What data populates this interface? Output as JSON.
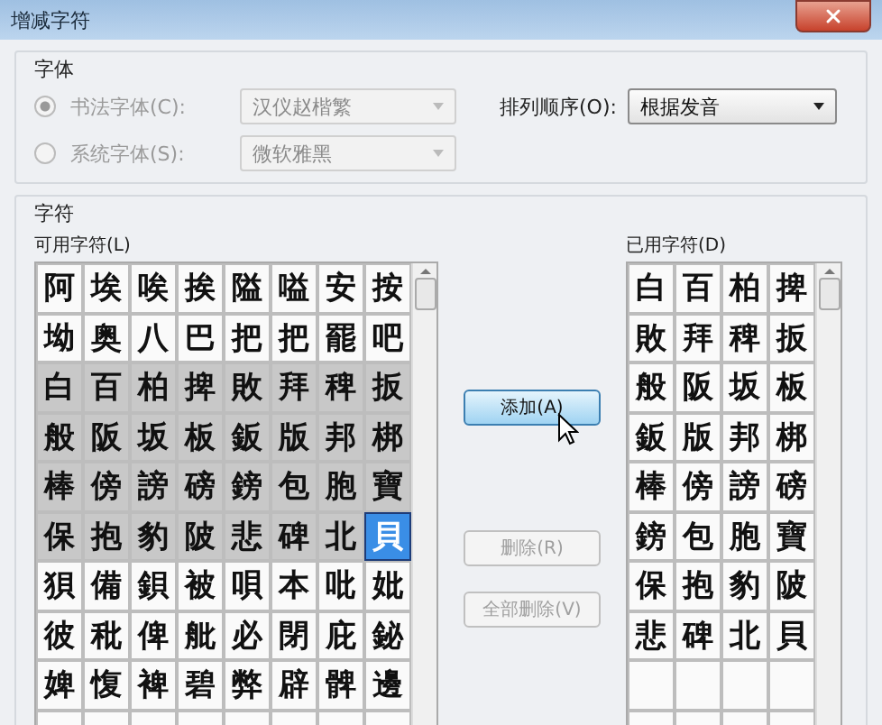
{
  "window": {
    "title": "增减字符"
  },
  "font_group": {
    "title": "字体",
    "options": [
      {
        "label": "书法字体(C):",
        "selected": true,
        "disabled": true,
        "value": "汉仪赵楷繁"
      },
      {
        "label": "系统字体(S):",
        "selected": false,
        "disabled": true,
        "value": "微软雅黑"
      }
    ],
    "sort": {
      "label": "排列顺序(O):",
      "value": "根据发音"
    }
  },
  "chars_group": {
    "title": "字符",
    "available": {
      "label": "可用字符(L)",
      "cells": [
        {
          "char": "阿",
          "used": false,
          "selected": false
        },
        {
          "char": "埃",
          "used": false,
          "selected": false
        },
        {
          "char": "唉",
          "used": false,
          "selected": false
        },
        {
          "char": "挨",
          "used": false,
          "selected": false
        },
        {
          "char": "隘",
          "used": false,
          "selected": false
        },
        {
          "char": "嗌",
          "used": false,
          "selected": false
        },
        {
          "char": "安",
          "used": false,
          "selected": false
        },
        {
          "char": "按",
          "used": false,
          "selected": false
        },
        {
          "char": "坳",
          "used": false,
          "selected": false
        },
        {
          "char": "奥",
          "used": false,
          "selected": false
        },
        {
          "char": "八",
          "used": false,
          "selected": false
        },
        {
          "char": "巴",
          "used": false,
          "selected": false
        },
        {
          "char": "把",
          "used": false,
          "selected": false
        },
        {
          "char": "把",
          "used": false,
          "selected": false
        },
        {
          "char": "罷",
          "used": false,
          "selected": false
        },
        {
          "char": "吧",
          "used": false,
          "selected": false
        },
        {
          "char": "白",
          "used": true,
          "selected": false
        },
        {
          "char": "百",
          "used": true,
          "selected": false
        },
        {
          "char": "柏",
          "used": true,
          "selected": false
        },
        {
          "char": "捭",
          "used": true,
          "selected": false
        },
        {
          "char": "敗",
          "used": true,
          "selected": false
        },
        {
          "char": "拜",
          "used": true,
          "selected": false
        },
        {
          "char": "稗",
          "used": true,
          "selected": false
        },
        {
          "char": "扳",
          "used": true,
          "selected": false
        },
        {
          "char": "般",
          "used": true,
          "selected": false
        },
        {
          "char": "阪",
          "used": true,
          "selected": false
        },
        {
          "char": "坂",
          "used": true,
          "selected": false
        },
        {
          "char": "板",
          "used": true,
          "selected": false
        },
        {
          "char": "鈑",
          "used": true,
          "selected": false
        },
        {
          "char": "版",
          "used": true,
          "selected": false
        },
        {
          "char": "邦",
          "used": true,
          "selected": false
        },
        {
          "char": "梆",
          "used": true,
          "selected": false
        },
        {
          "char": "棒",
          "used": true,
          "selected": false
        },
        {
          "char": "傍",
          "used": true,
          "selected": false
        },
        {
          "char": "謗",
          "used": true,
          "selected": false
        },
        {
          "char": "磅",
          "used": true,
          "selected": false
        },
        {
          "char": "鎊",
          "used": true,
          "selected": false
        },
        {
          "char": "包",
          "used": true,
          "selected": false
        },
        {
          "char": "胞",
          "used": true,
          "selected": false
        },
        {
          "char": "寶",
          "used": true,
          "selected": false
        },
        {
          "char": "保",
          "used": true,
          "selected": false
        },
        {
          "char": "抱",
          "used": true,
          "selected": false
        },
        {
          "char": "豹",
          "used": true,
          "selected": false
        },
        {
          "char": "陂",
          "used": true,
          "selected": false
        },
        {
          "char": "悲",
          "used": true,
          "selected": false
        },
        {
          "char": "碑",
          "used": true,
          "selected": false
        },
        {
          "char": "北",
          "used": true,
          "selected": false
        },
        {
          "char": "貝",
          "used": true,
          "selected": true
        },
        {
          "char": "狽",
          "used": false,
          "selected": false
        },
        {
          "char": "備",
          "used": false,
          "selected": false
        },
        {
          "char": "鋇",
          "used": false,
          "selected": false
        },
        {
          "char": "被",
          "used": false,
          "selected": false
        },
        {
          "char": "唄",
          "used": false,
          "selected": false
        },
        {
          "char": "本",
          "used": false,
          "selected": false
        },
        {
          "char": "吡",
          "used": false,
          "selected": false
        },
        {
          "char": "妣",
          "used": false,
          "selected": false
        },
        {
          "char": "彼",
          "used": false,
          "selected": false
        },
        {
          "char": "秕",
          "used": false,
          "selected": false
        },
        {
          "char": "俾",
          "used": false,
          "selected": false
        },
        {
          "char": "舭",
          "used": false,
          "selected": false
        },
        {
          "char": "必",
          "used": false,
          "selected": false
        },
        {
          "char": "閉",
          "used": false,
          "selected": false
        },
        {
          "char": "庇",
          "used": false,
          "selected": false
        },
        {
          "char": "鉍",
          "used": false,
          "selected": false
        },
        {
          "char": "婢",
          "used": false,
          "selected": false
        },
        {
          "char": "愎",
          "used": false,
          "selected": false
        },
        {
          "char": "裨",
          "used": false,
          "selected": false
        },
        {
          "char": "碧",
          "used": false,
          "selected": false
        },
        {
          "char": "弊",
          "used": false,
          "selected": false
        },
        {
          "char": "辟",
          "used": false,
          "selected": false
        },
        {
          "char": "髀",
          "used": false,
          "selected": false
        },
        {
          "char": "邊",
          "used": false,
          "selected": false
        }
      ]
    },
    "buttons": [
      {
        "label": "添加(A)",
        "disabled": false,
        "hovered": true
      },
      {
        "label": "删除(R)",
        "disabled": true,
        "hovered": false
      },
      {
        "label": "全部删除(V)",
        "disabled": true,
        "hovered": false
      }
    ],
    "used": {
      "label": "已用字符(D)",
      "cells": [
        "白",
        "百",
        "柏",
        "捭",
        "敗",
        "拜",
        "稗",
        "扳",
        "般",
        "阪",
        "坂",
        "板",
        "鈑",
        "版",
        "邦",
        "梆",
        "棒",
        "傍",
        "謗",
        "磅",
        "鎊",
        "包",
        "胞",
        "寶",
        "保",
        "抱",
        "豹",
        "陂",
        "悲",
        "碑",
        "北",
        "貝"
      ]
    }
  }
}
